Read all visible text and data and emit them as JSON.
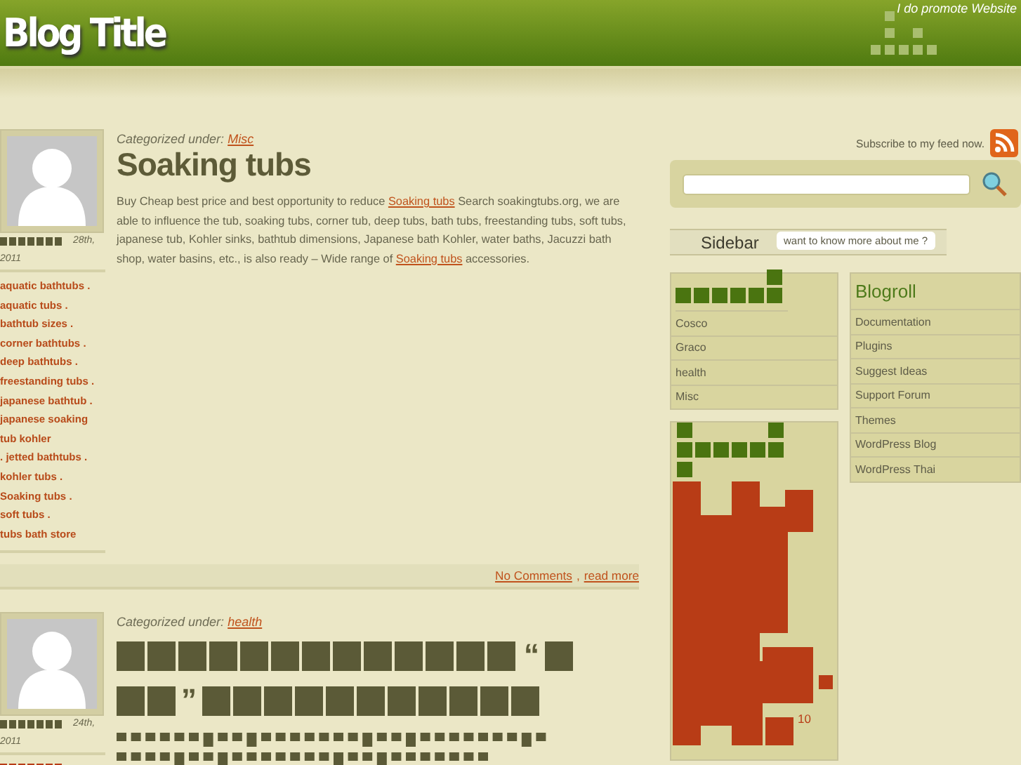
{
  "header": {
    "blog_title": "Blog Title",
    "tagline": "I do promote Website"
  },
  "posts": [
    {
      "date": "28th,",
      "year": "2011",
      "category_label": "Categorized under:",
      "category": "Misc",
      "title": "Soaking tubs",
      "body": [
        {
          "text": "Buy Cheap best price and best opportunity to reduce "
        },
        {
          "text": "Soaking tubs",
          "link": true
        },
        {
          "text": " Search soakingtubs.org, we are able to influence the tub, soaking tubs, corner tub, deep tubs, bath tubs, freestanding tubs, soft tubs, japanese tub, Kohler sinks, bathtub dimensions, Japanese bath Kohler, water baths, Jacuzzi bath shop, water basins, etc., is also ready – Wide range of "
        },
        {
          "text": "Soaking tubs",
          "link": true
        },
        {
          "text": " accessories."
        }
      ],
      "tag_separator": ".",
      "tags": [
        "aquatic bathtubs",
        "aquatic tubs",
        "bathtub sizes",
        "corner bathtubs",
        "deep bathtubs",
        "freestanding tubs",
        "japanese bathtub",
        "japanese soaking tub kohler",
        "jetted bathtubs",
        "kohler tubs",
        "Soaking tubs",
        "soft tubs",
        "tubs bath store"
      ],
      "comments": "No Comments",
      "comma": ",",
      "read_more": "read more"
    },
    {
      "date": "24th,",
      "year": "2011",
      "category_label": "Categorized under:",
      "category": "health",
      "title_quotes": [
        "“",
        "”"
      ]
    }
  ],
  "sidebar": {
    "subscribe": "Subscribe to my feed now.",
    "about_tab": "want to know more about me ?",
    "sidebar_label": "Sidebar",
    "categories": [
      "Cosco",
      "Graco",
      "health",
      "Misc"
    ],
    "blogroll_title": "Blogroll",
    "blogroll": [
      "Documentation",
      "Plugins",
      "Suggest Ideas",
      "Support Forum",
      "Themes",
      "WordPress Blog",
      "WordPress Thai"
    ],
    "calendar_day": "10"
  }
}
